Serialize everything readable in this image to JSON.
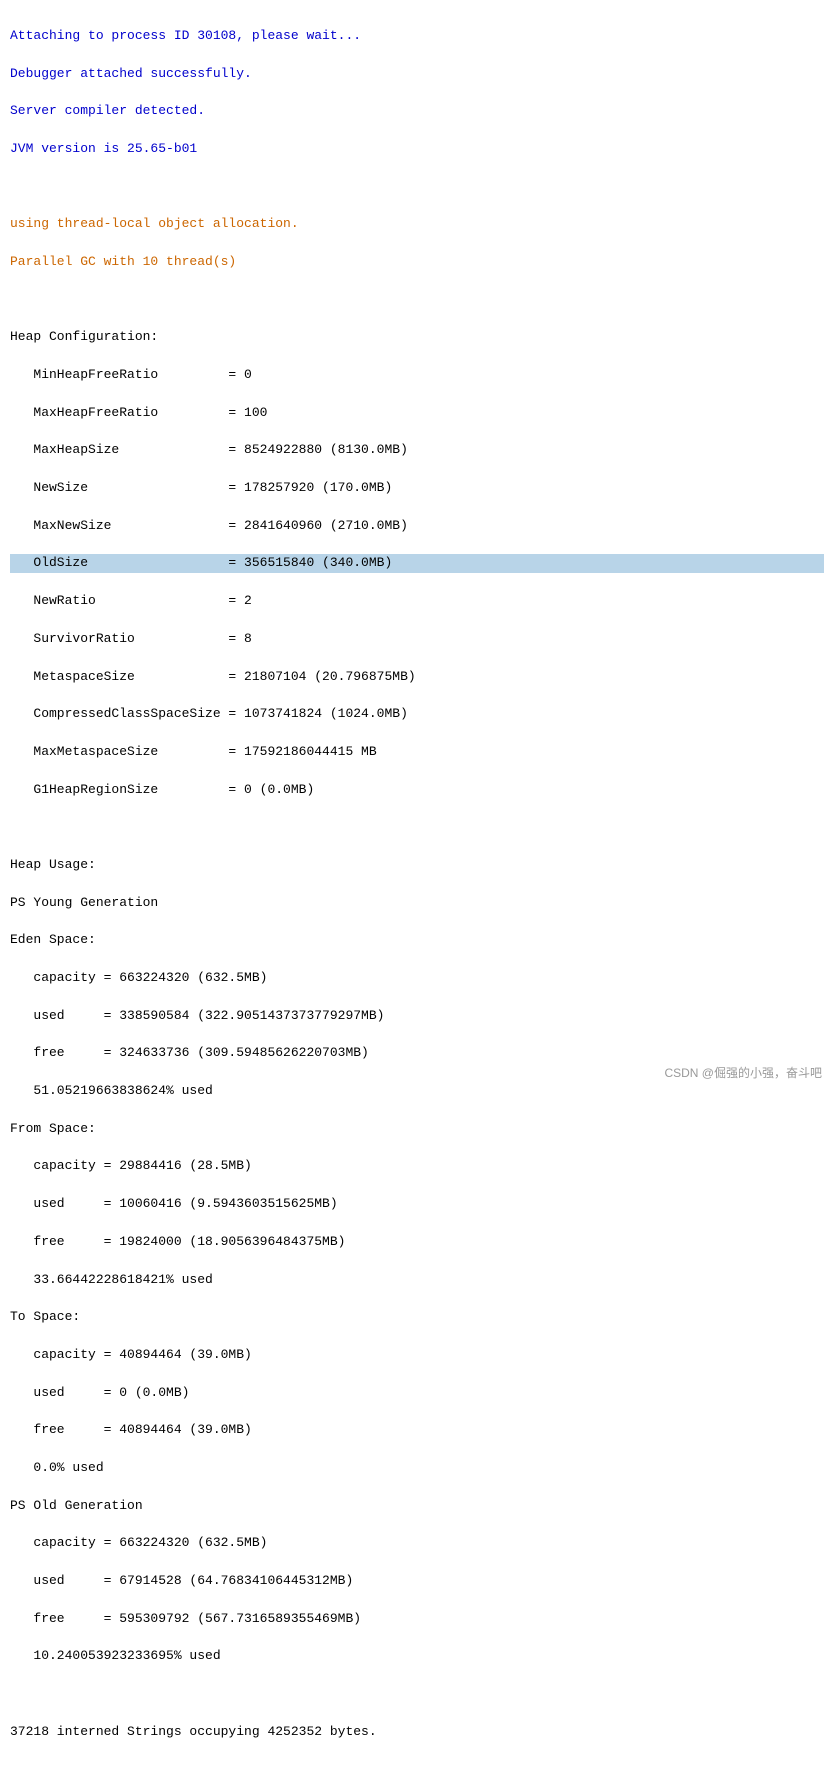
{
  "terminal": {
    "lines": [
      {
        "text": "Attaching to process ID 30108, please wait...",
        "color": "blue",
        "highlight": false
      },
      {
        "text": "Debugger attached successfully.",
        "color": "blue",
        "highlight": false
      },
      {
        "text": "Server compiler detected.",
        "color": "blue",
        "highlight": false
      },
      {
        "text": "JVM version is 25.65-b01",
        "color": "blue",
        "highlight": false
      },
      {
        "text": "",
        "color": "black",
        "highlight": false
      },
      {
        "text": "using thread-local object allocation.",
        "color": "orange",
        "highlight": false
      },
      {
        "text": "Parallel GC with 10 thread(s)",
        "color": "orange",
        "highlight": false
      },
      {
        "text": "",
        "color": "black",
        "highlight": false
      },
      {
        "text": "Heap Configuration:",
        "color": "black",
        "highlight": false
      },
      {
        "text": "   MinHeapFreeRatio         = 0",
        "color": "black",
        "highlight": false
      },
      {
        "text": "   MaxHeapFreeRatio         = 100",
        "color": "black",
        "highlight": false
      },
      {
        "text": "   MaxHeapSize              = 8524922880 (8130.0MB)",
        "color": "black",
        "highlight": false
      },
      {
        "text": "   NewSize                  = 178257920 (170.0MB)",
        "color": "black",
        "highlight": false
      },
      {
        "text": "   MaxNewSize               = 2841640960 (2710.0MB)",
        "color": "black",
        "highlight": false
      },
      {
        "text": "   OldSize                  = 356515840 (340.0MB)",
        "color": "black",
        "highlight": true
      },
      {
        "text": "   NewRatio                 = 2",
        "color": "black",
        "highlight": false
      },
      {
        "text": "   SurvivorRatio            = 8",
        "color": "black",
        "highlight": false
      },
      {
        "text": "   MetaspaceSize            = 21807104 (20.796875MB)",
        "color": "black",
        "highlight": false
      },
      {
        "text": "   CompressedClassSpaceSize = 1073741824 (1024.0MB)",
        "color": "black",
        "highlight": false
      },
      {
        "text": "   MaxMetaspaceSize         = 17592186044415 MB",
        "color": "black",
        "highlight": false
      },
      {
        "text": "   G1HeapRegionSize         = 0 (0.0MB)",
        "color": "black",
        "highlight": false
      },
      {
        "text": "",
        "color": "black",
        "highlight": false
      },
      {
        "text": "Heap Usage:",
        "color": "black",
        "highlight": false
      },
      {
        "text": "PS Young Generation",
        "color": "black",
        "highlight": false
      },
      {
        "text": "Eden Space:",
        "color": "black",
        "highlight": false
      },
      {
        "text": "   capacity = 663224320 (632.5MB)",
        "color": "black",
        "highlight": false
      },
      {
        "text": "   used     = 338590584 (322.9051437373779297MB)",
        "color": "black",
        "highlight": false
      },
      {
        "text": "   free     = 324633736 (309.5948562622070​3MB)",
        "color": "black",
        "highlight": false
      },
      {
        "text": "   51.05219663838624% used",
        "color": "black",
        "highlight": false
      },
      {
        "text": "From Space:",
        "color": "black",
        "highlight": false
      },
      {
        "text": "   capacity = 29884416 (28.5MB)",
        "color": "black",
        "highlight": false
      },
      {
        "text": "   used     = 10060416 (9.594360351562​5MB)",
        "color": "black",
        "highlight": false
      },
      {
        "text": "   free     = 19824000 (18.90563964843​75MB)",
        "color": "black",
        "highlight": false
      },
      {
        "text": "   33.66442228618421% used",
        "color": "black",
        "highlight": false
      },
      {
        "text": "To Space:",
        "color": "black",
        "highlight": false
      },
      {
        "text": "   capacity = 40894464 (39.0MB)",
        "color": "black",
        "highlight": false
      },
      {
        "text": "   used     = 0 (0.0MB)",
        "color": "black",
        "highlight": false
      },
      {
        "text": "   free     = 40894464 (39.0MB)",
        "color": "black",
        "highlight": false
      },
      {
        "text": "   0.0% used",
        "color": "black",
        "highlight": false
      },
      {
        "text": "PS Old Generation",
        "color": "black",
        "highlight": false
      },
      {
        "text": "   capacity = 663224320 (632.5MB)",
        "color": "black",
        "highlight": false
      },
      {
        "text": "   used     = 67914528 (64.76834106445312MB)",
        "color": "black",
        "highlight": false
      },
      {
        "text": "   free     = 595309792 (567.7316589355469MB)",
        "color": "black",
        "highlight": false
      },
      {
        "text": "   10.240053923233695% used",
        "color": "black",
        "highlight": false
      },
      {
        "text": "",
        "color": "black",
        "highlight": false
      },
      {
        "text": "37218 interned Strings occupying 4252352 bytes.",
        "color": "black",
        "highlight": false
      }
    ]
  },
  "watermark": {
    "text": "CSDN @倔强的小强，奋斗吧"
  }
}
